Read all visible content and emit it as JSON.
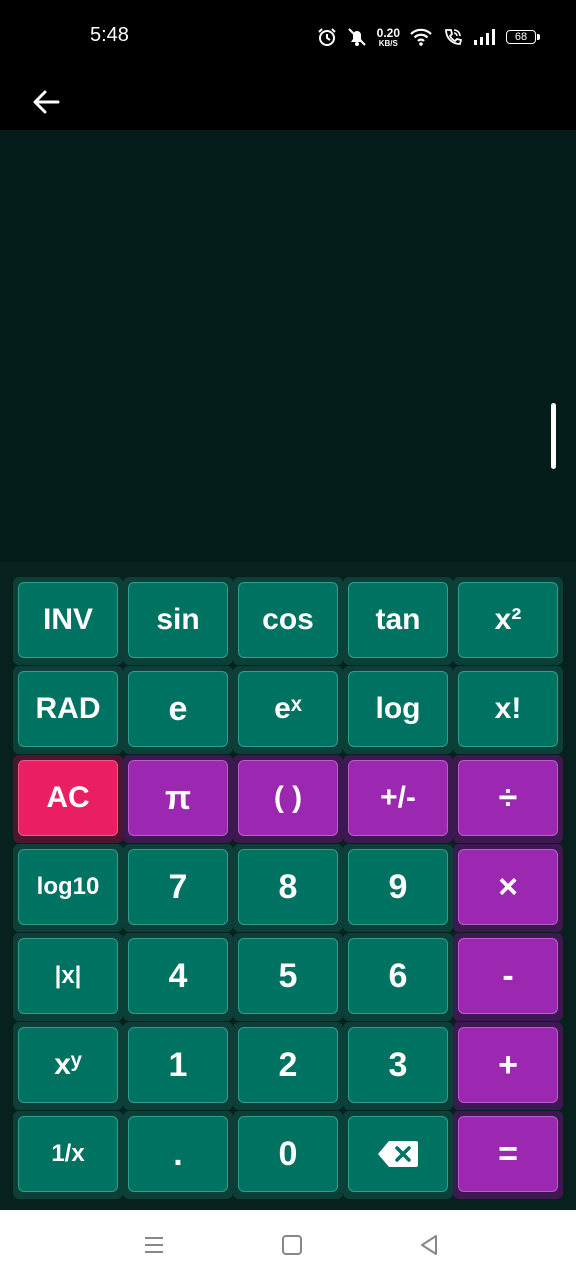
{
  "status": {
    "time": "5:48",
    "net_speed_value": "0.20",
    "net_speed_unit": "KB/S",
    "battery": "68"
  },
  "colors": {
    "display_bg": "#041d1a",
    "key_teal": "#007262",
    "key_purple": "#9c27b0",
    "key_pink": "#e91e63"
  },
  "keys": [
    {
      "label": "INV",
      "style": "teal"
    },
    {
      "label": "sin",
      "style": "teal"
    },
    {
      "label": "cos",
      "style": "teal"
    },
    {
      "label": "tan",
      "style": "teal"
    },
    {
      "label": "x²",
      "style": "teal"
    },
    {
      "label": "RAD",
      "style": "teal"
    },
    {
      "label": "e",
      "style": "teal"
    },
    {
      "label": "eˣ",
      "style": "teal"
    },
    {
      "label": "log",
      "style": "teal"
    },
    {
      "label": "x!",
      "style": "teal"
    },
    {
      "label": "AC",
      "style": "pink"
    },
    {
      "label": "π",
      "style": "purple"
    },
    {
      "label": "( )",
      "style": "purple"
    },
    {
      "label": "+/-",
      "style": "purple"
    },
    {
      "label": "÷",
      "style": "purple"
    },
    {
      "label": "log10",
      "style": "teal"
    },
    {
      "label": "7",
      "style": "teal"
    },
    {
      "label": "8",
      "style": "teal"
    },
    {
      "label": "9",
      "style": "teal"
    },
    {
      "label": "×",
      "style": "purple"
    },
    {
      "label": "|x|",
      "style": "teal"
    },
    {
      "label": "4",
      "style": "teal"
    },
    {
      "label": "5",
      "style": "teal"
    },
    {
      "label": "6",
      "style": "teal"
    },
    {
      "label": "-",
      "style": "purple"
    },
    {
      "label": "xʸ",
      "style": "teal"
    },
    {
      "label": "1",
      "style": "teal"
    },
    {
      "label": "2",
      "style": "teal"
    },
    {
      "label": "3",
      "style": "teal"
    },
    {
      "label": "+",
      "style": "purple"
    },
    {
      "label": "1/x",
      "style": "teal"
    },
    {
      "label": ".",
      "style": "teal"
    },
    {
      "label": "0",
      "style": "teal"
    },
    {
      "label": "",
      "style": "teal",
      "icon": "backspace-icon"
    },
    {
      "label": "=",
      "style": "purple"
    }
  ]
}
